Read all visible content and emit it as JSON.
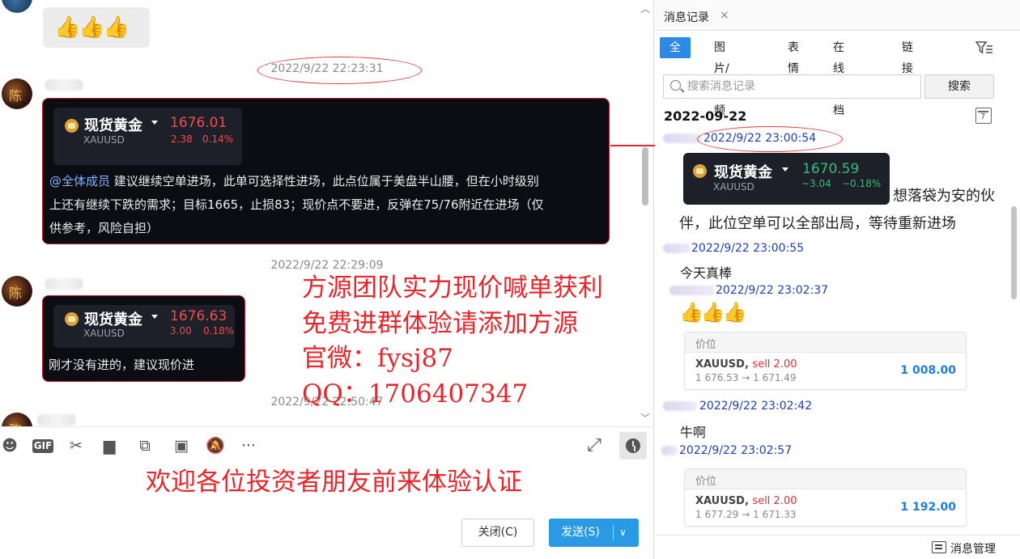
{
  "chat": {
    "thumbs": "👍👍👍",
    "messages": [
      {
        "timestamp": "2022/9/22 22:23:31",
        "quote": {
          "name": "现货黄金",
          "symbol": "XAUUSD",
          "price": "1676.01",
          "change": "2.38",
          "change_pct": "0.14%"
        },
        "mention": "@全体成员",
        "line1": " 建议继续空单进场，此单可选择性进场，此点位属于美盘半山腰，但在小时级别",
        "line2": "上还有继续下跌的需求；目标1665，止损83；现价点不要进，反弹在75/76附近在进场（仅",
        "line3": "供参考，风险自担）"
      },
      {
        "timestamp": "2022/9/22 22:29:09",
        "quote": {
          "name": "现货黄金",
          "symbol": "XAUUSD",
          "price": "1676.63",
          "change": "3.00",
          "change_pct": "0.18%"
        },
        "text": "刚才没有进的，建议现价进"
      }
    ],
    "partial_timestamp": "2022/9/22 22:50:47",
    "avatar_glyph": "陈",
    "overlay": {
      "line1": "方源团队实力现价喊单获利",
      "line2": "免费进群体验请添加方源",
      "line3": "官微：fysj87",
      "line4": "QQ：1706407347",
      "bottom": "欢迎各位投资者朋友前来体验认证"
    },
    "toolbar_icons": [
      "emoji-icon",
      "gif-icon",
      "scissors-icon",
      "folder-icon",
      "shortcut-icon",
      "image-icon",
      "mute-bell-icon",
      "more-icon",
      "expand-icon",
      "history-clock-icon"
    ],
    "toolbar": {
      "gif_label": "GIF",
      "more": "···",
      "expand": "⤢"
    },
    "buttons": {
      "close": "关闭(C)",
      "send": "发送(S)",
      "send_arrow": "∨"
    }
  },
  "history": {
    "tab_title": "消息记录",
    "tab_close": "×",
    "filters": [
      "全部",
      "图片/视频",
      "表情",
      "在线文档",
      "链接"
    ],
    "search_placeholder": "搜索消息记录",
    "search_button": "搜索",
    "date_heading": "2022-09-22",
    "calendar_day": "7",
    "entries": [
      {
        "time": "2022/9/22 23:00:54",
        "quote": {
          "name": "现货黄金",
          "symbol": "XAUUSD",
          "price": "1670.59",
          "change": "−3.04",
          "change_pct": "−0.18%"
        },
        "text_inline": "想落袋为安的伙",
        "text_line": "伴，此位空单可以全部出局，等待重新进场"
      },
      {
        "time": "2022/9/22 23:00:55",
        "text": "今天真棒"
      },
      {
        "time": "2022/9/22 23:02:37",
        "thumbs": "👍👍👍",
        "card": {
          "header": "价位",
          "symbol": "XAUUSD,",
          "side": "sell 2.00",
          "range": "1 676.53 → 1 671.49",
          "pnl": "1 008.00"
        }
      },
      {
        "time": "2022/9/22 23:02:42",
        "text": "牛啊"
      },
      {
        "time": "2022/9/22 23:02:57",
        "card": {
          "header": "价位",
          "symbol": "XAUUSD,",
          "side": "sell 2.00",
          "range": "1 677.29 → 1 671.33",
          "pnl": "1 192.00"
        }
      }
    ],
    "footer": "消息管理"
  }
}
